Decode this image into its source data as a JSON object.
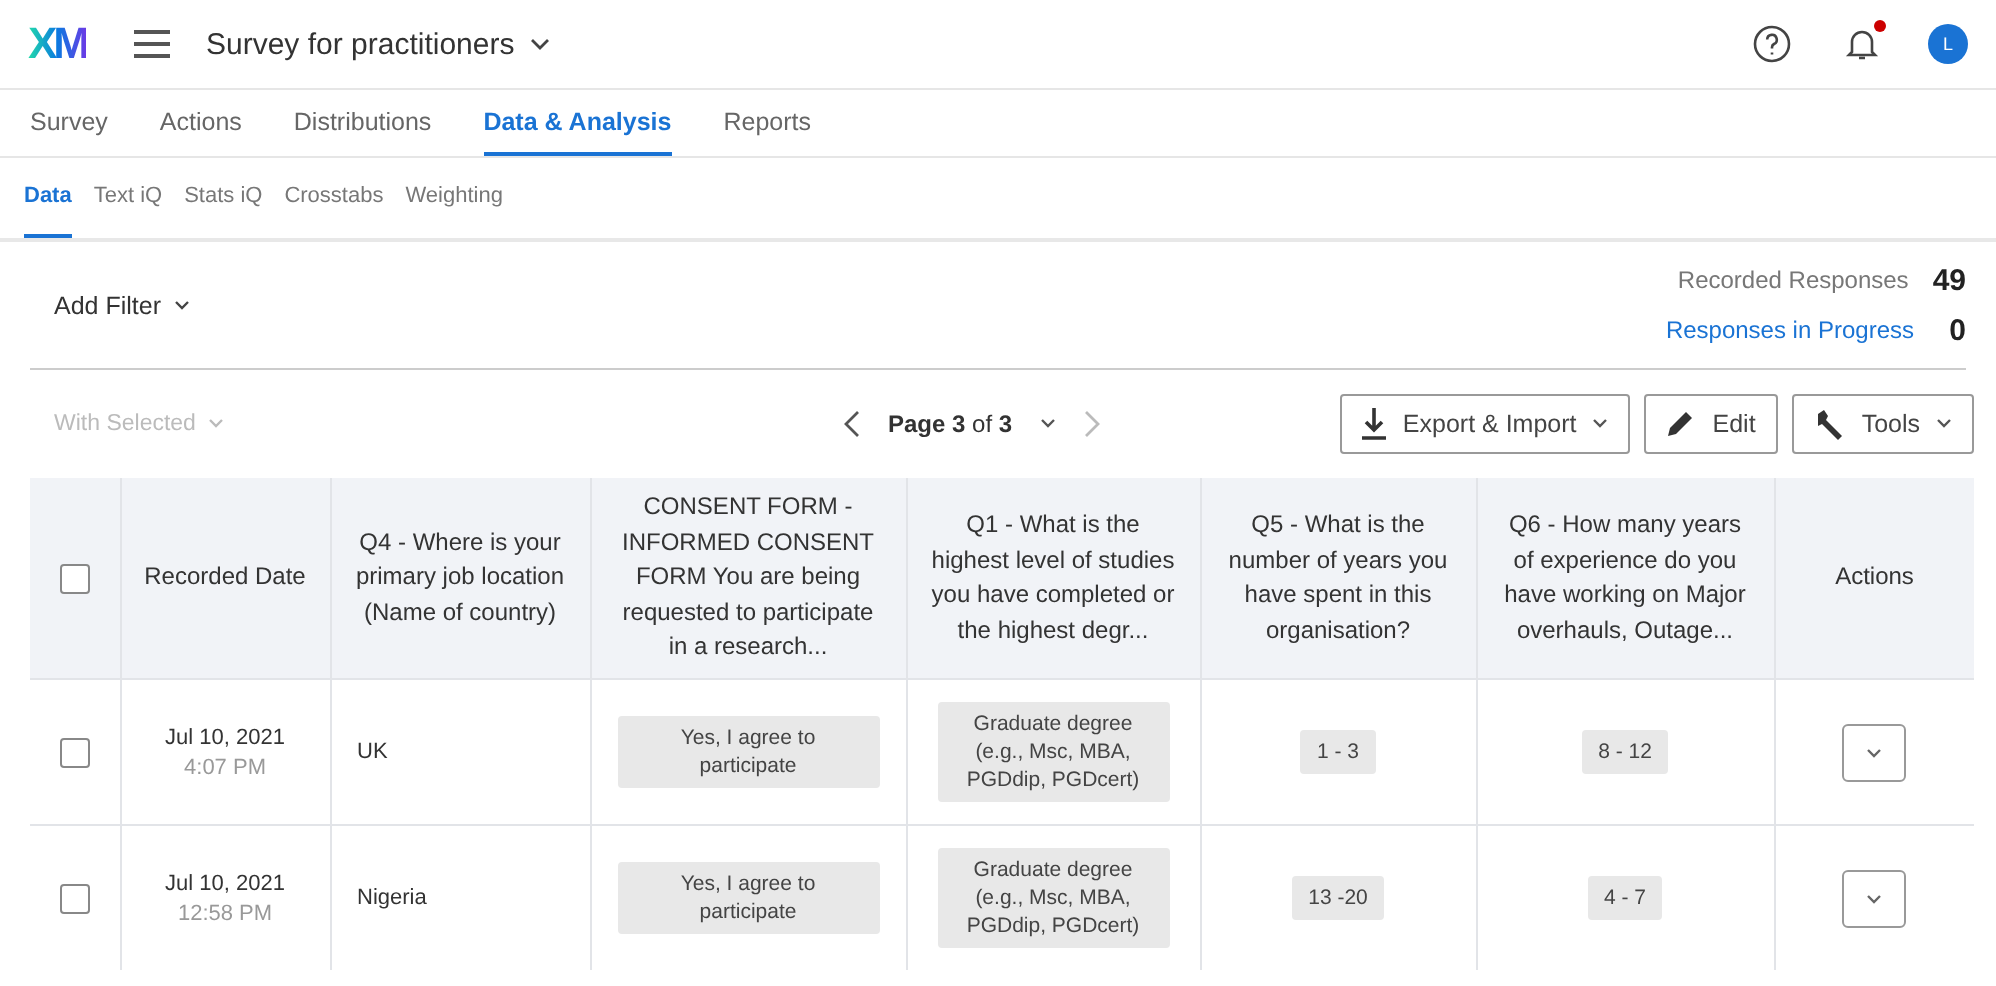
{
  "header": {
    "logo": "XM",
    "survey_title": "Survey for practitioners",
    "notifications_unread": true,
    "avatar_letter": "L"
  },
  "tabs": [
    {
      "label": "Survey",
      "selected": false
    },
    {
      "label": "Actions",
      "selected": false
    },
    {
      "label": "Distributions",
      "selected": false
    },
    {
      "label": "Data & Analysis",
      "selected": true
    },
    {
      "label": "Reports",
      "selected": false
    }
  ],
  "subtabs": [
    {
      "label": "Data",
      "selected": true
    },
    {
      "label": "Text iQ",
      "selected": false
    },
    {
      "label": "Stats iQ",
      "selected": false
    },
    {
      "label": "Crosstabs",
      "selected": false
    },
    {
      "label": "Weighting",
      "selected": false
    }
  ],
  "filter": {
    "label": "Add Filter"
  },
  "stats": [
    {
      "label": "Recorded Responses",
      "value": "49",
      "kind": "plain"
    },
    {
      "label": "Responses in Progress",
      "value": "0",
      "kind": "link"
    }
  ],
  "toolbar": {
    "with_selected": {
      "label": "With Selected",
      "disabled": true
    },
    "pager": "**Page 3** of **3**",
    "buttons": [
      {
        "label": "Export & Import",
        "kind": "export"
      },
      {
        "label": "Edit",
        "kind": "edit"
      },
      {
        "label": "Tools",
        "kind": "tools"
      }
    ]
  },
  "table": {
    "select_all_checked": false,
    "columns": [
      "Recorded Date",
      "Q4 - Where is your primary job location (Name of country)",
      "CONSENT FORM - INFORMED CONSENT FORM You are being requested to participate in a research...",
      "Q1 - What is the highest level of studies you have completed or the highest degr...",
      "Q5 - What is the number of years you have spent in this organisation?",
      "Q6 - How many years of experience do you have working on Major overhauls, Outage...",
      "Actions"
    ],
    "rows": [
      {
        "checked": false,
        "date": "Jul 10, 2021",
        "time": "4:07 PM",
        "location": "UK",
        "consent": "Yes, I agree to participate",
        "education": "Graduate degree (e.g., Msc, MBA, PGDdip, PGDcert)",
        "years_org": "1 - 3",
        "years_experience": "8 - 12"
      },
      {
        "checked": false,
        "date": "Jul 10, 2021",
        "time": "12:58 PM",
        "location": "Nigeria",
        "consent": "Yes, I agree to participate",
        "education": "Graduate degree (e.g., Msc, MBA, PGDdip, PGDcert)",
        "years_org": "13 -20",
        "years_experience": "4 - 7"
      }
    ]
  }
}
